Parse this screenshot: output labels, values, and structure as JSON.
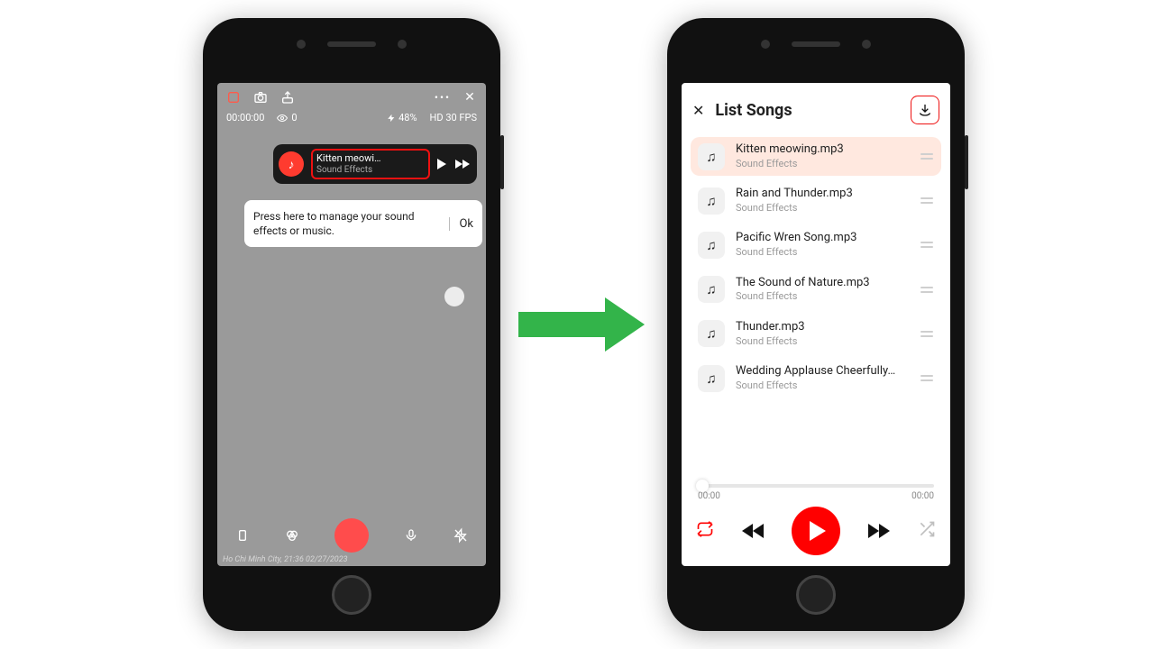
{
  "left": {
    "timer": "00:00:00",
    "views": "0",
    "battery": "48%",
    "quality": "HD 30 FPS",
    "song_title": "Kitten meowi…",
    "song_category": "Sound Effects",
    "tip_text": "Press here to manage your sound effects or music.",
    "tip_ok": "Ok",
    "footer": "Ho Chi Minh City, 21:36 02/27/2023"
  },
  "right": {
    "header_title": "List Songs",
    "songs": [
      {
        "name": "Kitten meowing.mp3",
        "category": "Sound Effects"
      },
      {
        "name": "Rain and Thunder.mp3",
        "category": "Sound Effects"
      },
      {
        "name": "Pacific Wren Song.mp3",
        "category": "Sound Effects"
      },
      {
        "name": "The Sound of Nature.mp3",
        "category": "Sound Effects"
      },
      {
        "name": "Thunder.mp3",
        "category": "Sound Effects"
      },
      {
        "name": "Wedding Applause Cheerfully…",
        "category": "Sound Effects"
      }
    ],
    "time_current": "00:00",
    "time_total": "00:00"
  }
}
